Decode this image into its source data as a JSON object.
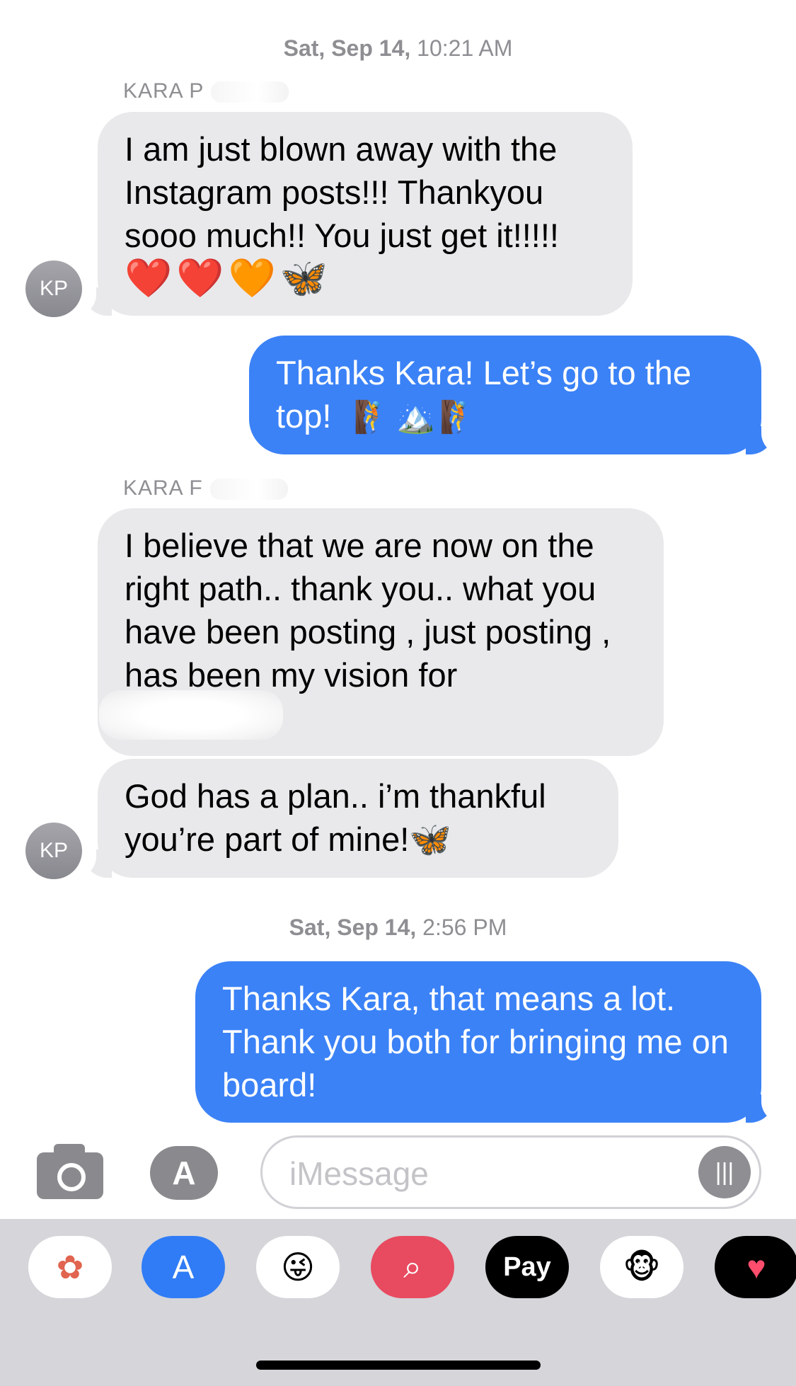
{
  "timestamps": [
    {
      "day": "Sat, Sep 14,",
      "time": " 10:21 AM"
    },
    {
      "day": "Sat, Sep 14,",
      "time": " 2:56 PM"
    }
  ],
  "senders": [
    "KARA P",
    "KARA F"
  ],
  "avatar_initials": "KP",
  "messages": [
    {
      "dir": "in",
      "text": "I am just blown away with the Instagram posts!!! Thankyou sooo much!! You just get it!!!!!",
      "emoji": "❤️❤️🧡🦋"
    },
    {
      "dir": "out",
      "text": "Thanks Kara! Let’s go to the top!",
      "emoji": "🧗🏔️🧗"
    },
    {
      "dir": "in",
      "text": "I believe that we are now on the right path.. thank you.. what you have been posting , just posting , has been my vision for",
      "emoji": ""
    },
    {
      "dir": "in",
      "text": "God has a plan.. i’m thankful you’re part of mine!",
      "emoji": "🦋"
    },
    {
      "dir": "out",
      "text": "Thanks Kara, that means a lot. Thank you both for bringing me on board!",
      "emoji": ""
    }
  ],
  "input": {
    "placeholder": "iMessage"
  },
  "apps": [
    {
      "name": "photos-app-icon",
      "glyph": "✿",
      "bg": "#ffffff",
      "color": "#e0644f"
    },
    {
      "name": "app-store-icon",
      "glyph": "A",
      "bg": "#2f7cf6",
      "color": "#ffffff"
    },
    {
      "name": "memoji-stickers-icon",
      "glyph": "😜",
      "bg": "#ffffff",
      "color": "#000000"
    },
    {
      "name": "web-search-icon",
      "glyph": "⌕",
      "bg": "#e84a5f",
      "color": "#ffffff"
    },
    {
      "name": "apple-pay-icon",
      "glyph": "Pay",
      "bg": "#000000",
      "color": "#ffffff"
    },
    {
      "name": "animoji-icon",
      "glyph": "🐵",
      "bg": "#ffffff",
      "color": "#000000"
    },
    {
      "name": "digital-touch-icon",
      "glyph": "♥",
      "bg": "#000000",
      "color": "#ff4d6d"
    }
  ]
}
